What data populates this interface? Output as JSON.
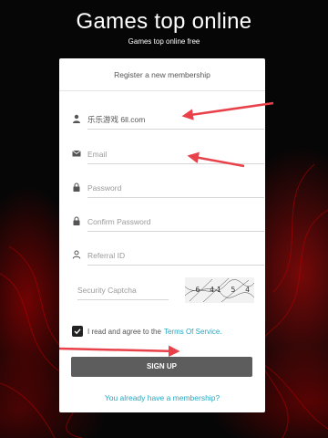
{
  "header": {
    "title": "Games top online",
    "subtitle": "Games top online free"
  },
  "form": {
    "heading": "Register a new membership",
    "username": {
      "value": "乐乐游戏 6ll.com",
      "icon": "user-icon"
    },
    "email": {
      "placeholder": "Email",
      "icon": "envelope-icon"
    },
    "password": {
      "placeholder": "Password",
      "icon": "lock-icon"
    },
    "confirm_password": {
      "placeholder": "Confirm Password",
      "icon": "lock-icon"
    },
    "referral": {
      "placeholder": "Referral ID",
      "icon": "user-outline-icon"
    },
    "captcha": {
      "placeholder": "Security Captcha",
      "image_text": "6 41 5 4"
    },
    "agree": {
      "text": "I read and agree to the",
      "link": "Terms Of Service",
      "suffix": ".",
      "checked": true
    },
    "signup_label": "SIGN UP",
    "login_link": "You already have a membership?"
  },
  "colors": {
    "accent_link": "#2aa6c2",
    "button": "#5d5d5d",
    "annotation_arrow": "#e8414a"
  }
}
